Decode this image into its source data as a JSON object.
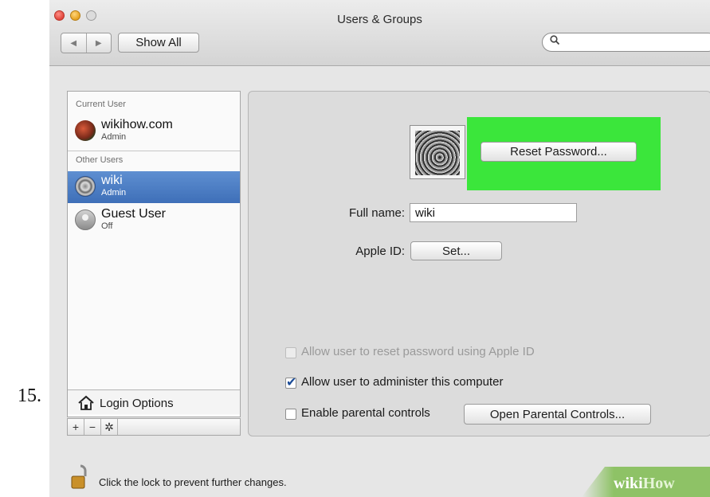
{
  "step_number": "15.",
  "window": {
    "title": "Users & Groups"
  },
  "toolbar": {
    "show_all_label": "Show All",
    "search_placeholder": ""
  },
  "sidebar": {
    "current_user_label": "Current User",
    "other_users_label": "Other Users",
    "users": [
      {
        "name": "wikihow.com",
        "role": "Admin",
        "selected": false
      },
      {
        "name": "wiki",
        "role": "Admin",
        "selected": true
      },
      {
        "name": "Guest User",
        "role": "Off",
        "selected": false
      }
    ],
    "login_options_label": "Login Options",
    "add_label": "+",
    "remove_label": "−",
    "action_label": "✲"
  },
  "detail": {
    "reset_password_label": "Reset Password...",
    "full_name_label": "Full name:",
    "full_name_value": "wiki",
    "apple_id_label": "Apple ID:",
    "apple_id_button": "Set...",
    "checkboxes": [
      {
        "label": "Allow user to reset password using Apple ID",
        "checked": false,
        "enabled": false
      },
      {
        "label": "Allow user to administer this computer",
        "checked": true,
        "enabled": true
      },
      {
        "label": "Enable parental controls",
        "checked": false,
        "enabled": true
      }
    ],
    "open_parental_controls_label": "Open Parental Controls..."
  },
  "lock": {
    "text": "Click the lock to prevent further changes."
  },
  "watermark": {
    "wiki": "wiki",
    "how": "How"
  },
  "colors": {
    "highlight": "#3be63b",
    "selection": "#4a7bc4"
  }
}
